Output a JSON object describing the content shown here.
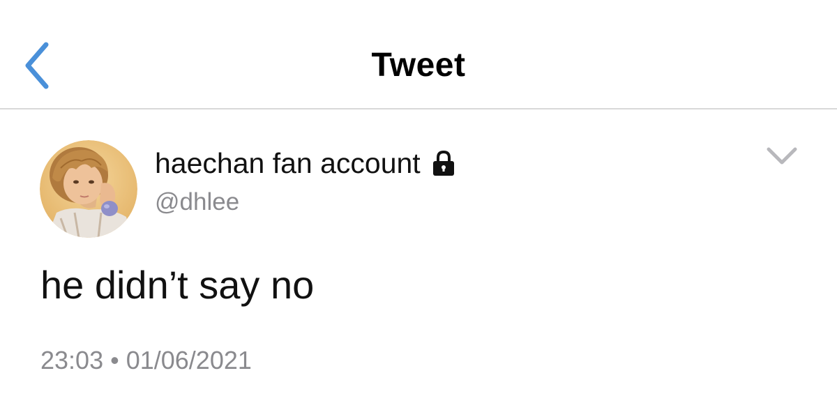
{
  "header": {
    "title": "Tweet",
    "back_icon": "chevron-left-icon",
    "accent_color": "#4a90d9"
  },
  "tweet": {
    "author": {
      "display_name": "haechan fan account",
      "handle": "@dhlee",
      "protected_icon": "lock-icon",
      "avatar": "profile-photo"
    },
    "menu_icon": "chevron-down-icon",
    "text": "he didn’t say no",
    "time": "23:03",
    "separator": "•",
    "date": "01/06/2021"
  },
  "colors": {
    "divider": "#d8d8d8",
    "secondary_text": "#8a8a8e",
    "chevron_gray": "#b8b8bc"
  }
}
